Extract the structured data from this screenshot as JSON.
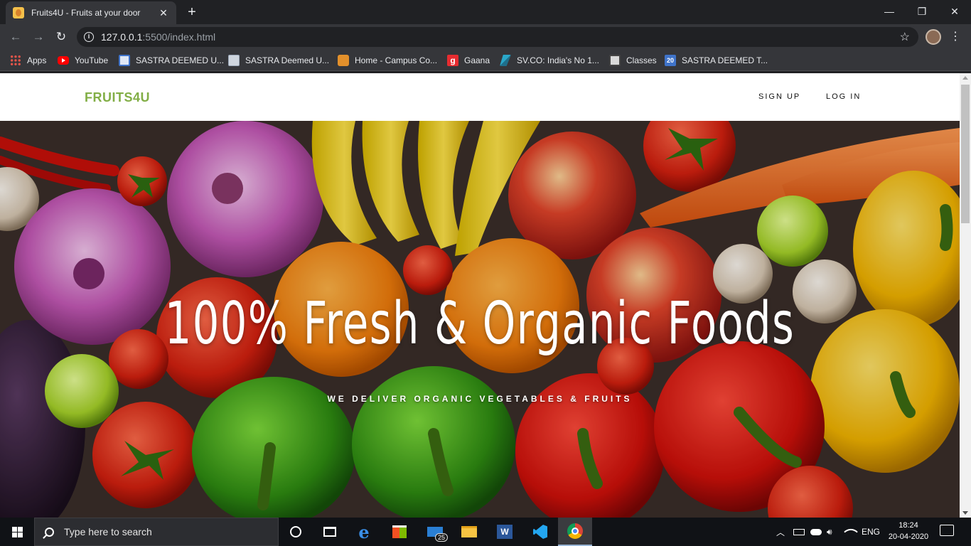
{
  "browser": {
    "tab": {
      "title": "Fruits4U - Fruits at your door",
      "close": "✕"
    },
    "new_tab": "+",
    "window": {
      "minimize": "—",
      "maximize": "❐",
      "close": "✕"
    },
    "nav": {
      "back": "←",
      "forward": "→",
      "reload": "↻"
    },
    "address": {
      "host": "127.0.0.1",
      "rest": ":5500/index.html"
    },
    "bookmarks": [
      {
        "label": "Apps",
        "icon": "apps-grid-icon",
        "color": "#e8554a"
      },
      {
        "label": "YouTube",
        "icon": "youtube-icon",
        "color": "#ff0000"
      },
      {
        "label": "SASTRA DEEMED U...",
        "icon": "sastra-icon",
        "color": "#3f73c9"
      },
      {
        "label": "SASTRA Deemed U...",
        "icon": "sastra-page-icon",
        "color": "#9aa7b8"
      },
      {
        "label": "Home - Campus Co...",
        "icon": "campus-icon",
        "color": "#e3902b"
      },
      {
        "label": "Gaana",
        "icon": "gaana-icon",
        "color": "#e72c30"
      },
      {
        "label": "SV.CO: India's No 1...",
        "icon": "svco-icon",
        "color": "#2aa7c9"
      },
      {
        "label": "Classes",
        "icon": "classes-icon",
        "color": "#d9d9d9"
      },
      {
        "label": "SASTRA DEEMED T...",
        "icon": "calendar-icon",
        "color": "#3f73c9"
      }
    ]
  },
  "site": {
    "brand": "FRUITS4U",
    "nav": {
      "signup": "SIGN UP",
      "login": "LOG IN"
    },
    "hero": {
      "title": "100% Fresh & Organic Foods",
      "subtitle": "WE DELIVER ORGANIC VEGETABLES & FRUITS"
    }
  },
  "taskbar": {
    "search_placeholder": "Type here to search",
    "mail_badge": "25",
    "calendar_day": "20",
    "lang": "ENG",
    "time": "18:24",
    "date": "20-04-2020"
  },
  "colors": {
    "brand": "#82ae46",
    "chrome_dark": "#202124",
    "chrome": "#35363a"
  }
}
